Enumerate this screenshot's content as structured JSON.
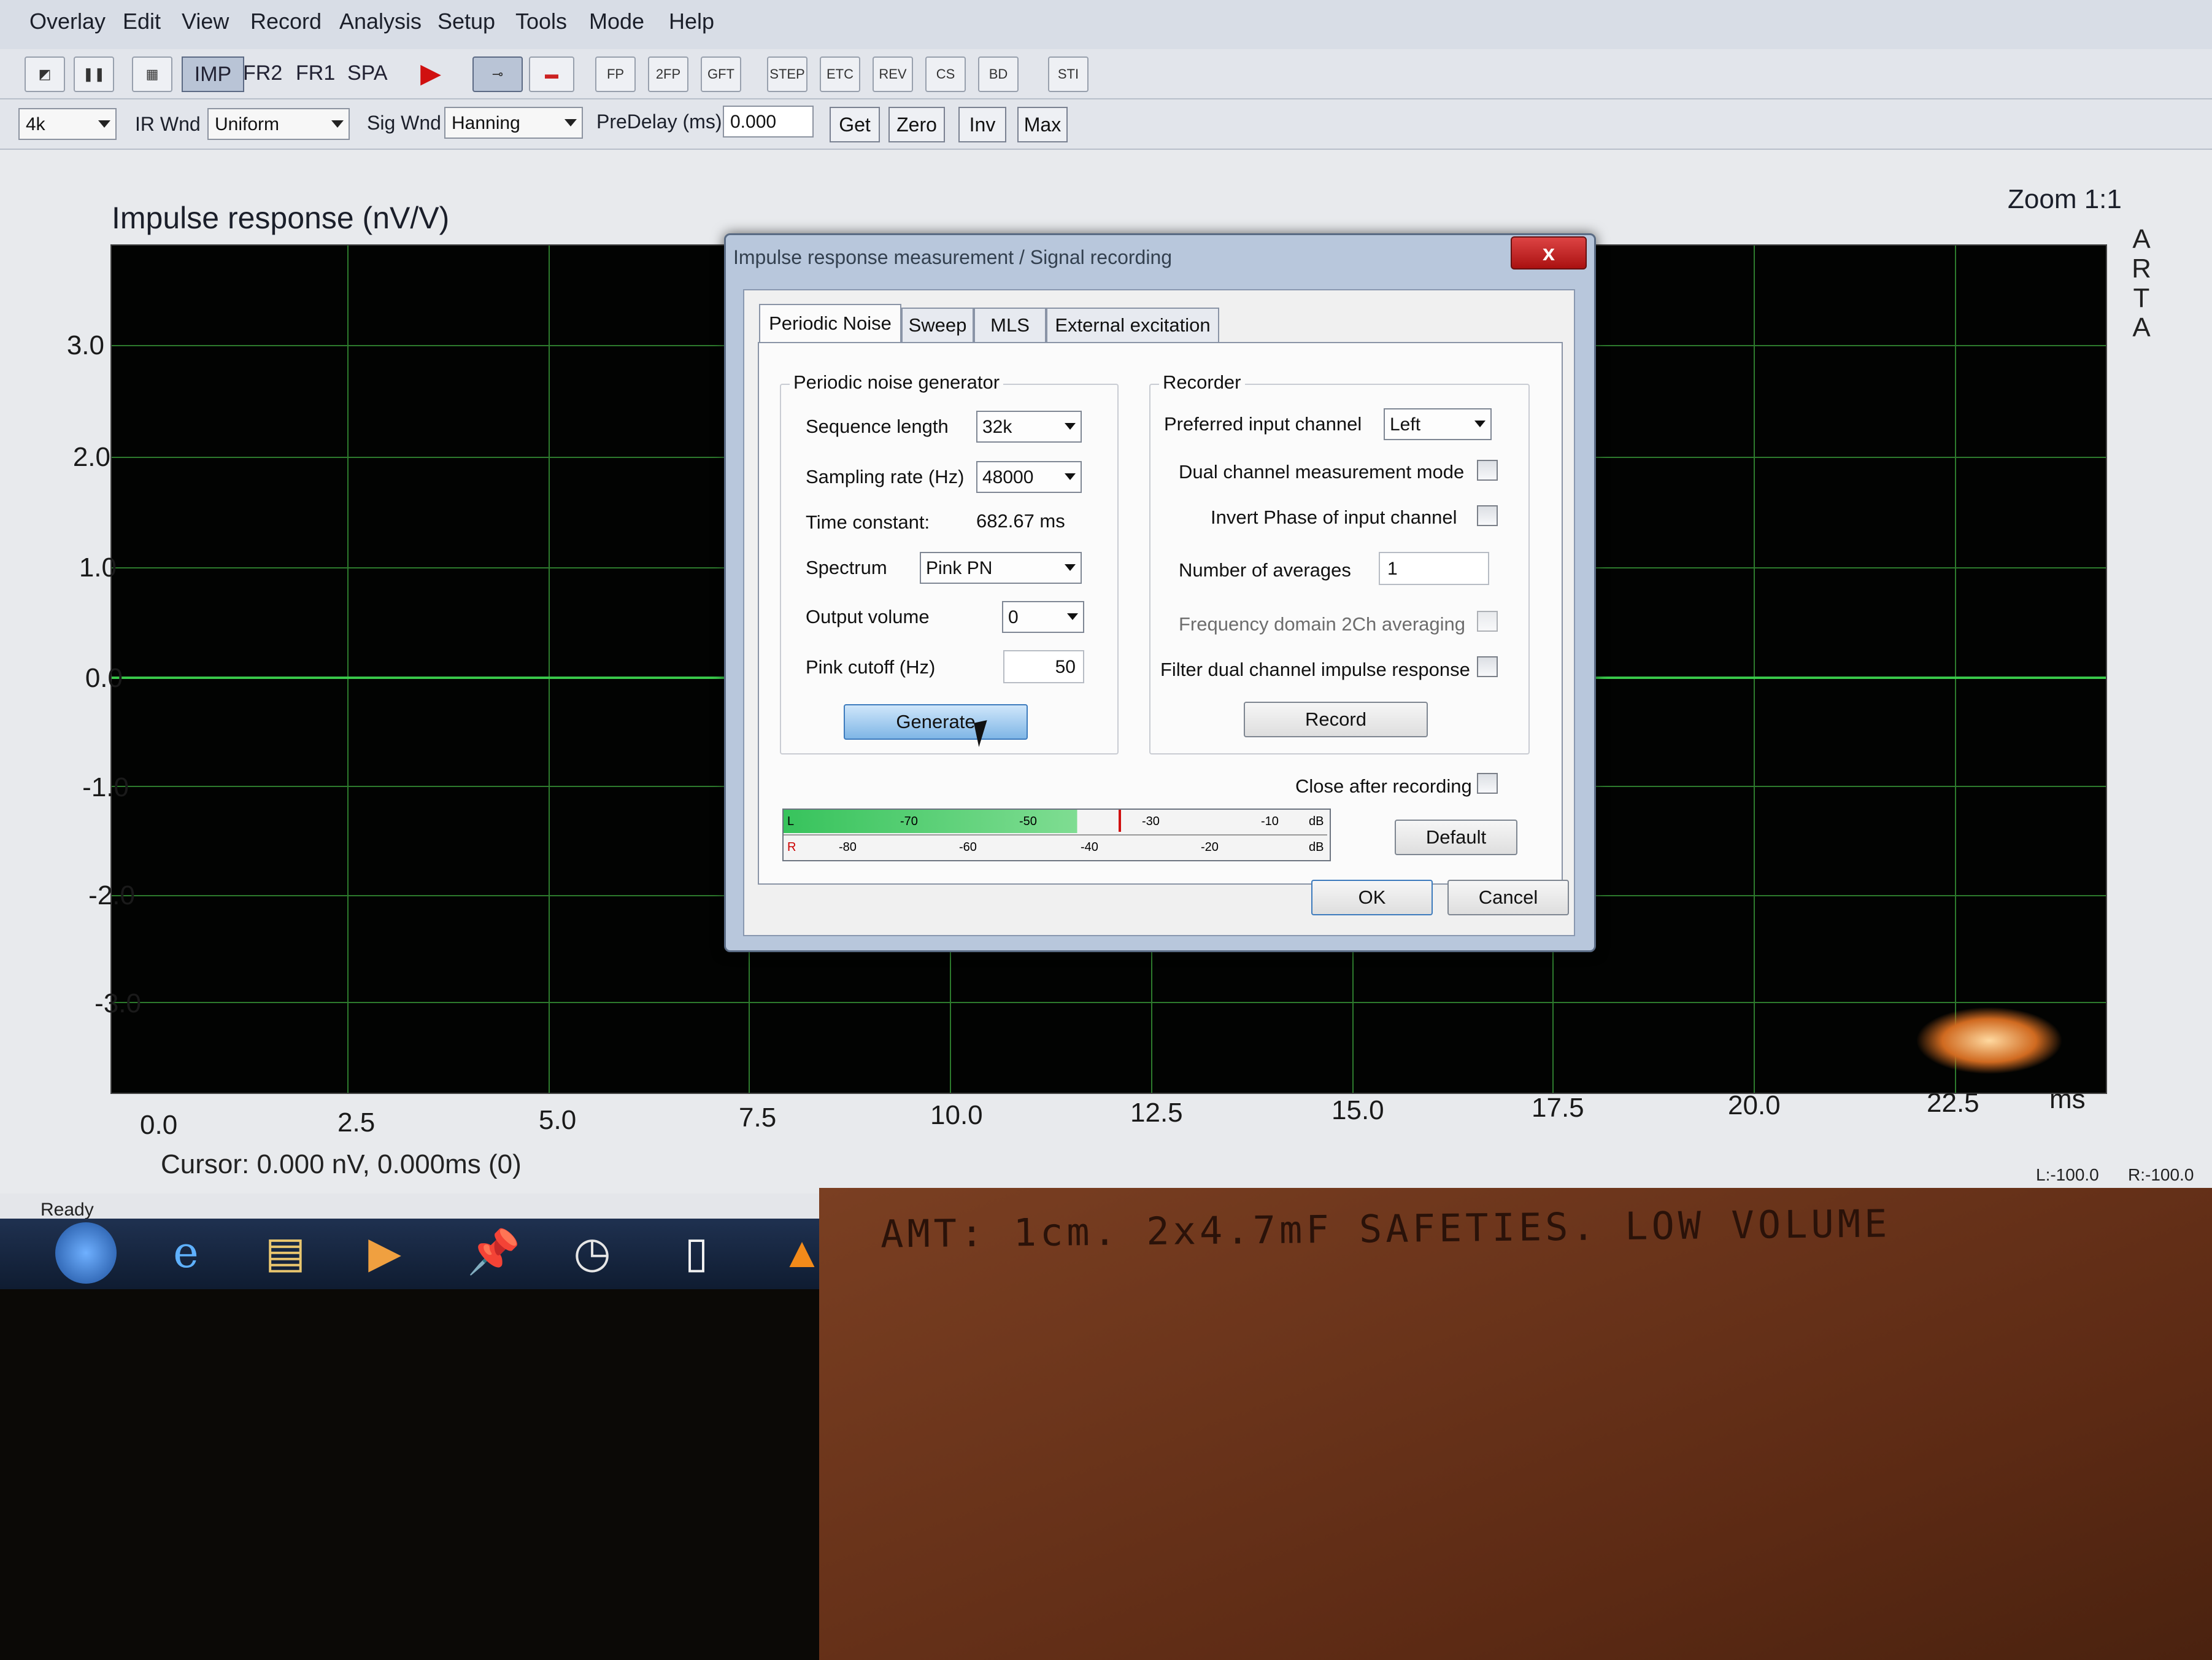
{
  "menubar": {
    "items": [
      "Overlay",
      "Edit",
      "View",
      "Record",
      "Analysis",
      "Setup",
      "Tools",
      "Mode",
      "Help"
    ]
  },
  "toolbar": {
    "mode_buttons": [
      "IMP",
      "FR2",
      "FR1",
      "SPA"
    ],
    "active_mode": "IMP",
    "icon_buttons": [
      "FP",
      "2FP",
      "GFT",
      "STEP",
      "ETC",
      "REV",
      "CS",
      "BD",
      "STI"
    ]
  },
  "toolbar2": {
    "fft_value": "4k",
    "ir_wnd_label": "IR Wnd",
    "ir_wnd_value": "Uniform",
    "sig_wnd_label": "Sig Wnd",
    "sig_wnd_value": "Hanning",
    "predelay_label": "PreDelay (ms)",
    "predelay_value": "0.000",
    "buttons": [
      "Get",
      "Zero",
      "Inv",
      "Max"
    ]
  },
  "plot": {
    "title": "Impulse response (nV/V)",
    "zoom": "Zoom 1:1",
    "brand": [
      "A",
      "R",
      "T",
      "A"
    ],
    "y_ticks": [
      "3.0",
      "2.0",
      "1.0",
      "0.0",
      "-1.0",
      "-2.0",
      "-3.0"
    ],
    "x_ticks": [
      "0.0",
      "2.5",
      "5.0",
      "7.5",
      "10.0",
      "12.5",
      "15.0",
      "17.5",
      "20.0",
      "22.5"
    ],
    "x_unit": "ms",
    "cursor_text": "Cursor: 0.000 nV, 0.000ms (0)",
    "status": "Ready",
    "levels": "L:-100.0",
    "levels_r": "R:-100.0"
  },
  "dialog": {
    "title": "Impulse response measurement / Signal recording",
    "close_label": "x",
    "tabs": [
      "Periodic Noise",
      "Sweep",
      "MLS",
      "External excitation"
    ],
    "selected_tab": "Periodic Noise",
    "generator": {
      "title": "Periodic noise generator",
      "sequence_length_label": "Sequence length",
      "sequence_length_value": "32k",
      "sampling_rate_label": "Sampling rate (Hz)",
      "sampling_rate_value": "48000",
      "time_constant_label": "Time constant:",
      "time_constant_value": "682.67 ms",
      "spectrum_label": "Spectrum",
      "spectrum_value": "Pink PN",
      "output_volume_label": "Output volume",
      "output_volume_value": "0",
      "pink_cutoff_label": "Pink cutoff (Hz)",
      "pink_cutoff_value": "50",
      "generate_label": "Generate"
    },
    "recorder": {
      "title": "Recorder",
      "preferred_input_label": "Preferred input channel",
      "preferred_input_value": "Left",
      "dual_channel_label": "Dual channel measurement mode",
      "invert_phase_label": "Invert Phase of input channel",
      "averages_label": "Number of averages",
      "averages_value": "1",
      "freq_domain_label": "Frequency domain 2Ch averaging",
      "filter_dual_label": "Filter dual channel impulse response",
      "record_label": "Record"
    },
    "close_after_label": "Close after recording",
    "meter": {
      "top_labels": [
        "L",
        "-70",
        "-50",
        "-30",
        "-10",
        "dB"
      ],
      "bottom_labels": [
        "R",
        "-80",
        "-60",
        "-40",
        "-20",
        "dB"
      ]
    },
    "default_label": "Default",
    "ok_label": "OK",
    "cancel_label": "Cancel"
  },
  "note": {
    "text": "AMT: 1cm. 2x4.7mF SAFETIES. LOW VOLUME"
  },
  "colors": {
    "trace": "#39c84a",
    "grid": "#2d7a2d",
    "plot_bg": "#020302"
  }
}
